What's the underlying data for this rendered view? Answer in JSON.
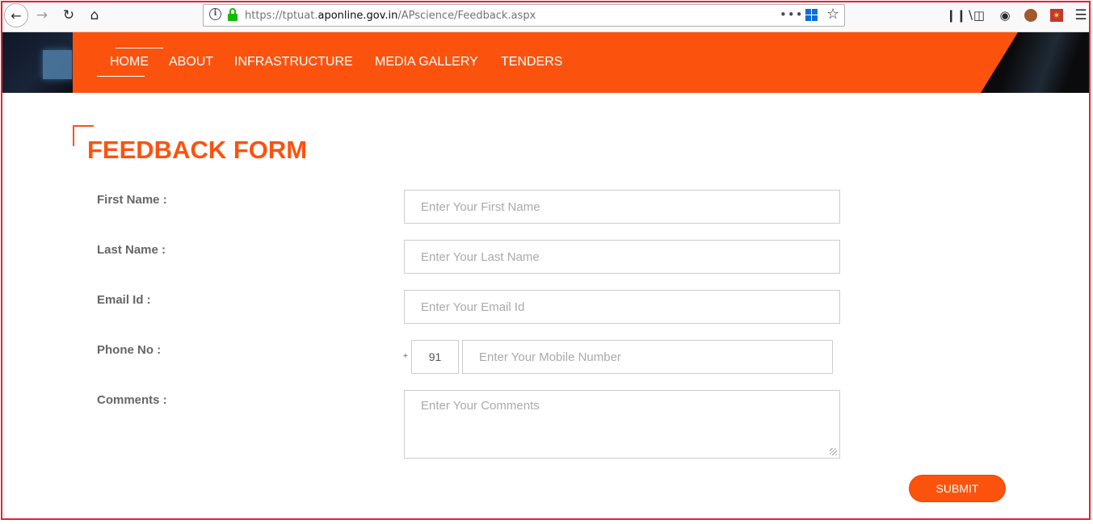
{
  "browser": {
    "url_prefix": "https://tptuat.",
    "url_domain": "aponline.gov.in",
    "url_path": "/APscience/Feedback.aspx",
    "icons": [
      "back-icon",
      "forward-icon",
      "reload-icon",
      "home-icon",
      "info-icon",
      "lock-icon",
      "more-icon",
      "windows-icon",
      "bookmark-star-icon",
      "library-icon",
      "sidebar-icon",
      "account-icon",
      "cookie-icon",
      "extension-icon",
      "menu-icon"
    ]
  },
  "nav": {
    "items": [
      {
        "label": "HOME"
      },
      {
        "label": "ABOUT"
      },
      {
        "label": "INFRASTRUCTURE"
      },
      {
        "label": "MEDIA GALLERY"
      },
      {
        "label": "TENDERS"
      }
    ],
    "active": "HOME"
  },
  "form": {
    "title": "FEEDBACK FORM",
    "first_name": {
      "label": "First Name :",
      "placeholder": "Enter Your First Name",
      "value": ""
    },
    "last_name": {
      "label": "Last Name :",
      "placeholder": "Enter Your Last Name",
      "value": ""
    },
    "email": {
      "label": "Email Id :",
      "placeholder": "Enter Your Email Id",
      "value": ""
    },
    "phone": {
      "label": "Phone No :",
      "plus": "+",
      "country_code": "91",
      "placeholder": "Enter Your Mobile Number",
      "value": ""
    },
    "comments": {
      "label": "Comments :",
      "placeholder": "Enter Your Comments",
      "value": ""
    },
    "submit_label": "SUBMIT"
  },
  "colors": {
    "accent": "#fb530e",
    "frame": "#e8222a",
    "label": "#666666"
  }
}
